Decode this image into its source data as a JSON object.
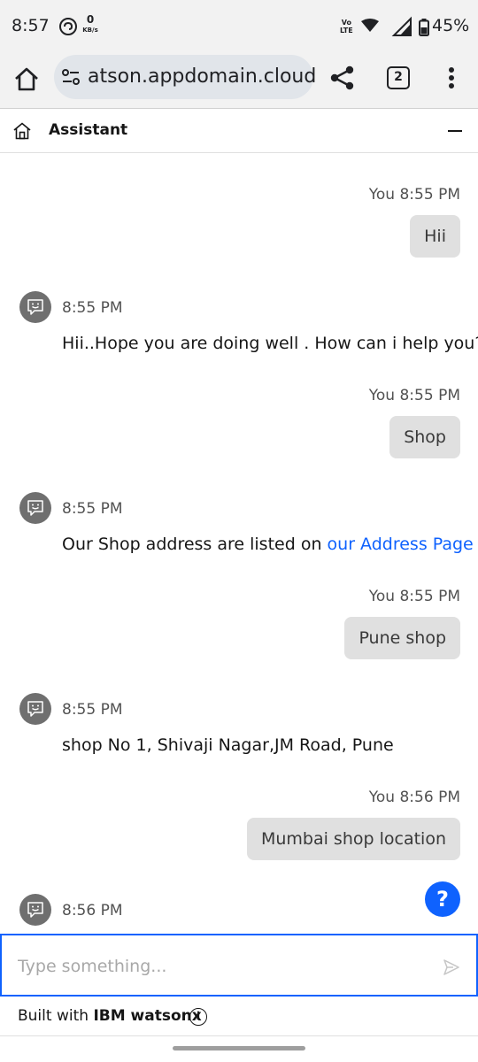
{
  "status_bar": {
    "time": "8:57",
    "speed_value": "0",
    "speed_unit": "KB/s",
    "network_line1": "Vo",
    "network_line2": "LTE",
    "battery": "45%"
  },
  "browser": {
    "url": "atson.appdomain.cloud",
    "tab_count": "2"
  },
  "assistant": {
    "title": "Assistant"
  },
  "messages": {
    "m1": {
      "meta": "You 8:55 PM",
      "text": "Hii"
    },
    "m2": {
      "time": "8:55 PM",
      "text": "Hii..Hope you are doing well . How can i help you?"
    },
    "m3": {
      "meta": "You 8:55 PM",
      "text": "Shop"
    },
    "m4": {
      "time": "8:55 PM",
      "text_prefix": "Our Shop address are listed on ",
      "link": "our Address Page"
    },
    "m5": {
      "meta": "You 8:55 PM",
      "text": "Pune shop"
    },
    "m6": {
      "time": "8:55 PM",
      "text": "shop No 1, Shivaji Nagar,JM Road, Pune"
    },
    "m7": {
      "meta": "You 8:56 PM",
      "text": "Mumbai shop location"
    },
    "m8": {
      "time": "8:56 PM"
    }
  },
  "help_button": "?",
  "input": {
    "placeholder": "Type something..."
  },
  "footer": {
    "prefix": "Built with ",
    "brand": "IBM watsonx",
    "info": "i"
  },
  "colors": {
    "accent": "#0f62fe",
    "user_bubble": "#e0e0e0",
    "avatar": "#6f6f6f",
    "chrome_bg": "#f2f2f2"
  }
}
